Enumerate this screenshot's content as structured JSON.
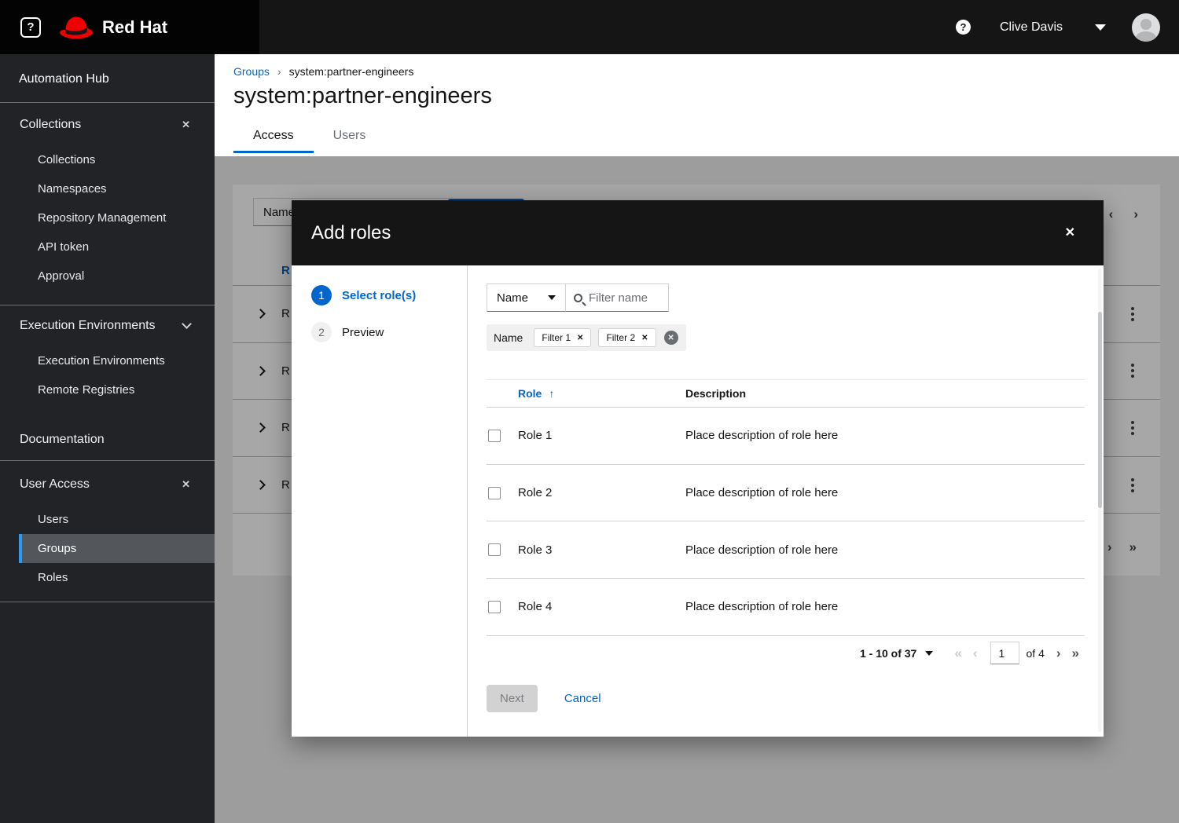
{
  "icons": {
    "about": "?",
    "help": "?",
    "breadcrumb_sep": "›",
    "section_close": "✕",
    "modal_close": "✕",
    "chip_close": "✕",
    "clear_all": "✕",
    "sort_asc": "↑",
    "pg_first": "«",
    "pg_prev": "‹",
    "pg_next": "›",
    "pg_last": "»"
  },
  "masthead": {
    "brand": "Red Hat",
    "user_name": "Clive Davis"
  },
  "sidebar": {
    "title": "Automation Hub",
    "sections": [
      {
        "label": "Collections",
        "items": [
          "Collections",
          "Namespaces",
          "Repository Management",
          "API token",
          "Approval"
        ]
      },
      {
        "label": "Execution Environments",
        "items": [
          "Execution Environments",
          "Remote Registries"
        ]
      },
      {
        "label": "Documentation",
        "items": []
      },
      {
        "label": "User Access",
        "items": [
          "Users",
          "Groups",
          "Roles"
        ],
        "selected": "Groups"
      }
    ]
  },
  "page": {
    "breadcrumb": {
      "parent": "Groups",
      "current": "system:partner-engineers"
    },
    "title": "system:partner-engineers",
    "tabs": [
      {
        "label": "Access"
      },
      {
        "label": "Users"
      }
    ],
    "active_tab": "Access"
  },
  "background_page": {
    "filter_value": "Name",
    "table_header_visible": "R",
    "rows_visible": [
      "R",
      "R",
      "R",
      "R"
    ]
  },
  "modal": {
    "title": "Add roles",
    "steps": [
      {
        "number": "1",
        "label": "Select role(s)"
      },
      {
        "number": "2",
        "label": "Preview"
      }
    ],
    "toolbar": {
      "filter_field": "Name",
      "search_placeholder": "Filter name"
    },
    "applied_filters": {
      "category": "Name",
      "chips": [
        "Filter 1",
        "Filter 2"
      ]
    },
    "table": {
      "col_role": "Role",
      "col_desc": "Description",
      "sorted_by": "Role",
      "rows": [
        {
          "role": "Role 1",
          "description": "Place description of role here"
        },
        {
          "role": "Role 2",
          "description": "Place description of role here"
        },
        {
          "role": "Role 3",
          "description": "Place description of role here"
        },
        {
          "role": "Role 4",
          "description": "Place description of role here"
        }
      ]
    },
    "pagination": {
      "range": "1 - 10",
      "total": "of 37",
      "page": "1",
      "pages": "of 4"
    },
    "footer": {
      "next": "Next",
      "cancel": "Cancel"
    }
  },
  "colors": {
    "accent_blue": "#0066cc",
    "masthead_black": "#151515",
    "brand_red": "#ee0000",
    "selected_nav_blue": "#2b9af3"
  }
}
